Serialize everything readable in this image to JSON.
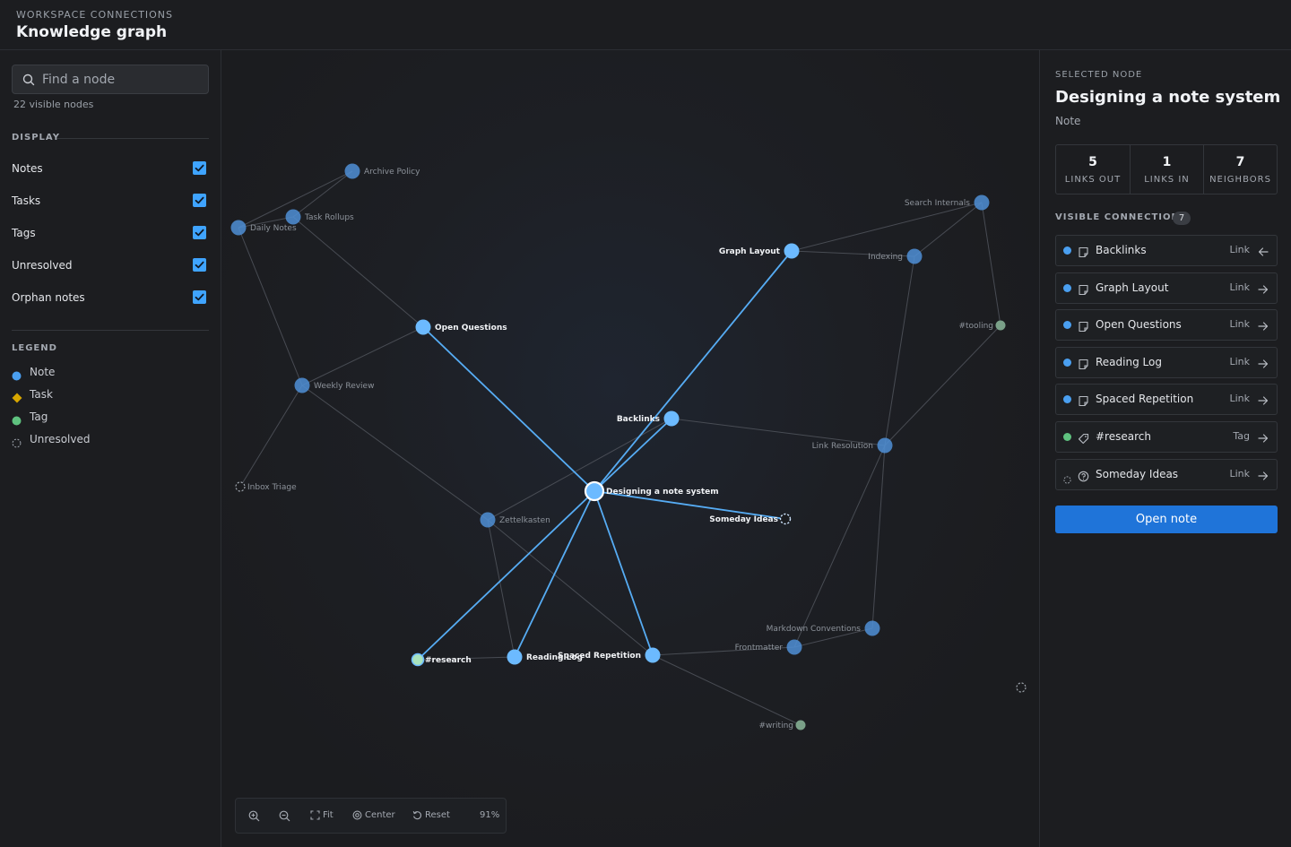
{
  "header": {
    "eyebrow": "WORKSPACE CONNECTIONS",
    "title": "Knowledge graph"
  },
  "sidebar": {
    "search_placeholder": "Find a node",
    "visible_count": "22 visible nodes",
    "display_title": "DISPLAY",
    "toggles": [
      {
        "label": "Notes",
        "checked": true
      },
      {
        "label": "Tasks",
        "checked": true
      },
      {
        "label": "Tags",
        "checked": true
      },
      {
        "label": "Unresolved",
        "checked": true
      },
      {
        "label": "Orphan notes",
        "checked": true
      }
    ],
    "legend_title": "LEGEND",
    "legend": [
      {
        "label": "Note",
        "shape": "circle",
        "color": "#4a9ff0"
      },
      {
        "label": "Task",
        "shape": "diamond",
        "color": "#d8a700"
      },
      {
        "label": "Tag",
        "shape": "circle",
        "color": "#5fc27f"
      },
      {
        "label": "Unresolved",
        "shape": "dashed-circle",
        "color": "#9aa0a8"
      }
    ]
  },
  "graph": {
    "colors": {
      "note": "#4f8fd6",
      "note_highlight": "#6cbaff",
      "tag": "#7aa088",
      "tag_highlight": "#a9e3bd",
      "unresolved": "#9aa0a8",
      "edge": "#50545c",
      "edge_highlight": "#5ab4ff"
    },
    "selected": "designing",
    "nodes": [
      {
        "id": "archive",
        "label": "Archive Policy",
        "type": "note"
      },
      {
        "id": "rollups",
        "label": "Task Rollups",
        "type": "note"
      },
      {
        "id": "daily",
        "label": "Daily Notes",
        "type": "note"
      },
      {
        "id": "openq",
        "label": "Open Questions",
        "type": "note"
      },
      {
        "id": "weekly",
        "label": "Weekly Review",
        "type": "note"
      },
      {
        "id": "inbox",
        "label": "Inbox Triage",
        "type": "unresolved"
      },
      {
        "id": "graphlayout",
        "label": "Graph Layout",
        "type": "note"
      },
      {
        "id": "indexing",
        "label": "Indexing",
        "type": "note"
      },
      {
        "id": "search",
        "label": "Search Internals",
        "type": "note"
      },
      {
        "id": "tooling",
        "label": "#tooling",
        "type": "tag"
      },
      {
        "id": "backlinks",
        "label": "Backlinks",
        "type": "note"
      },
      {
        "id": "linkres",
        "label": "Link Resolution",
        "type": "note"
      },
      {
        "id": "designing",
        "label": "Designing a note system",
        "type": "note"
      },
      {
        "id": "someday",
        "label": "Someday Ideas",
        "type": "unresolved"
      },
      {
        "id": "zettel",
        "label": "Zettelkasten",
        "type": "note"
      },
      {
        "id": "research",
        "label": "#research",
        "type": "tag"
      },
      {
        "id": "reading",
        "label": "Reading Log",
        "type": "note"
      },
      {
        "id": "spaced",
        "label": "Spaced Repetition",
        "type": "note"
      },
      {
        "id": "markdown",
        "label": "Markdown Conventions",
        "type": "note"
      },
      {
        "id": "frontmatter",
        "label": "Frontmatter",
        "type": "note"
      },
      {
        "id": "writing",
        "label": "#writing",
        "type": "tag"
      },
      {
        "id": "orphan",
        "label": "",
        "type": "unresolved"
      }
    ],
    "edges": [
      [
        "archive",
        "daily"
      ],
      [
        "archive",
        "rollups"
      ],
      [
        "daily",
        "rollups"
      ],
      [
        "rollups",
        "openq"
      ],
      [
        "daily",
        "weekly"
      ],
      [
        "weekly",
        "openq"
      ],
      [
        "weekly",
        "inbox"
      ],
      [
        "weekly",
        "zettel"
      ],
      [
        "graphlayout",
        "search"
      ],
      [
        "graphlayout",
        "indexing"
      ],
      [
        "indexing",
        "search"
      ],
      [
        "search",
        "tooling"
      ],
      [
        "indexing",
        "linkres"
      ],
      [
        "tooling",
        "linkres"
      ],
      [
        "backlinks",
        "linkres"
      ],
      [
        "linkres",
        "markdown"
      ],
      [
        "linkres",
        "frontmatter"
      ],
      [
        "frontmatter",
        "markdown"
      ],
      [
        "zettel",
        "backlinks"
      ],
      [
        "zettel",
        "reading"
      ],
      [
        "zettel",
        "spaced"
      ],
      [
        "research",
        "reading"
      ],
      [
        "spaced",
        "frontmatter"
      ],
      [
        "spaced",
        "writing"
      ],
      [
        "designing",
        "graphlayout"
      ],
      [
        "designing",
        "openq"
      ],
      [
        "designing",
        "backlinks"
      ],
      [
        "designing",
        "someday"
      ],
      [
        "designing",
        "research"
      ],
      [
        "designing",
        "reading"
      ],
      [
        "designing",
        "spaced"
      ]
    ],
    "toolbar": {
      "fit": "Fit",
      "center": "Center",
      "reset": "Reset",
      "zoom": "91%"
    }
  },
  "panel": {
    "eyebrow": "SELECTED NODE",
    "title": "Designing a note system",
    "type": "Note",
    "stats": [
      {
        "value": "5",
        "label": "LINKS OUT"
      },
      {
        "value": "1",
        "label": "LINKS IN"
      },
      {
        "value": "7",
        "label": "NEIGHBORS"
      }
    ],
    "connections_title": "VISIBLE CONNECTIONS",
    "connections_count": "7",
    "connections": [
      {
        "name": "Backlinks",
        "relation": "Link",
        "direction": "in",
        "type": "note"
      },
      {
        "name": "Graph Layout",
        "relation": "Link",
        "direction": "out",
        "type": "note"
      },
      {
        "name": "Open Questions",
        "relation": "Link",
        "direction": "out",
        "type": "note"
      },
      {
        "name": "Reading Log",
        "relation": "Link",
        "direction": "out",
        "type": "note"
      },
      {
        "name": "Spaced Repetition",
        "relation": "Link",
        "direction": "out",
        "type": "note"
      },
      {
        "name": "#research",
        "relation": "Tag",
        "direction": "out",
        "type": "tag"
      },
      {
        "name": "Someday Ideas",
        "relation": "Link",
        "direction": "out",
        "type": "unresolved"
      }
    ],
    "open_button": "Open note"
  }
}
